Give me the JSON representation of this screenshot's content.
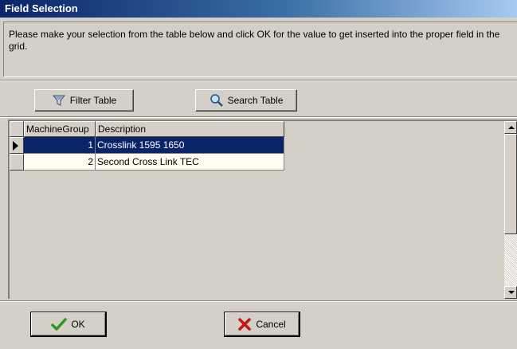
{
  "window": {
    "title": "Field Selection"
  },
  "message": "Please make your selection from the table below and click OK for the value to get inserted into the proper field in the grid.",
  "toolbar": {
    "filter_label": "Filter Table",
    "search_label": "Search Table"
  },
  "grid": {
    "columns": [
      "MachineGroup",
      "Description"
    ],
    "rows": [
      {
        "machine_group": "1",
        "description": "Crosslink 1595 1650",
        "selected": true
      },
      {
        "machine_group": "2",
        "description": "Second Cross Link TEC",
        "selected": false
      }
    ]
  },
  "footer": {
    "ok_label": "OK",
    "cancel_label": "Cancel"
  },
  "colors": {
    "title_bar": "#0a246a",
    "selected_row": "#0a246a",
    "row_background": "#fffbef",
    "ok_check": "#2e9a1e",
    "cancel_x": "#c81414"
  },
  "icons": {
    "filter": "filter-funnel-icon",
    "search": "magnifier-icon",
    "ok": "checkmark-icon",
    "cancel": "x-icon"
  }
}
